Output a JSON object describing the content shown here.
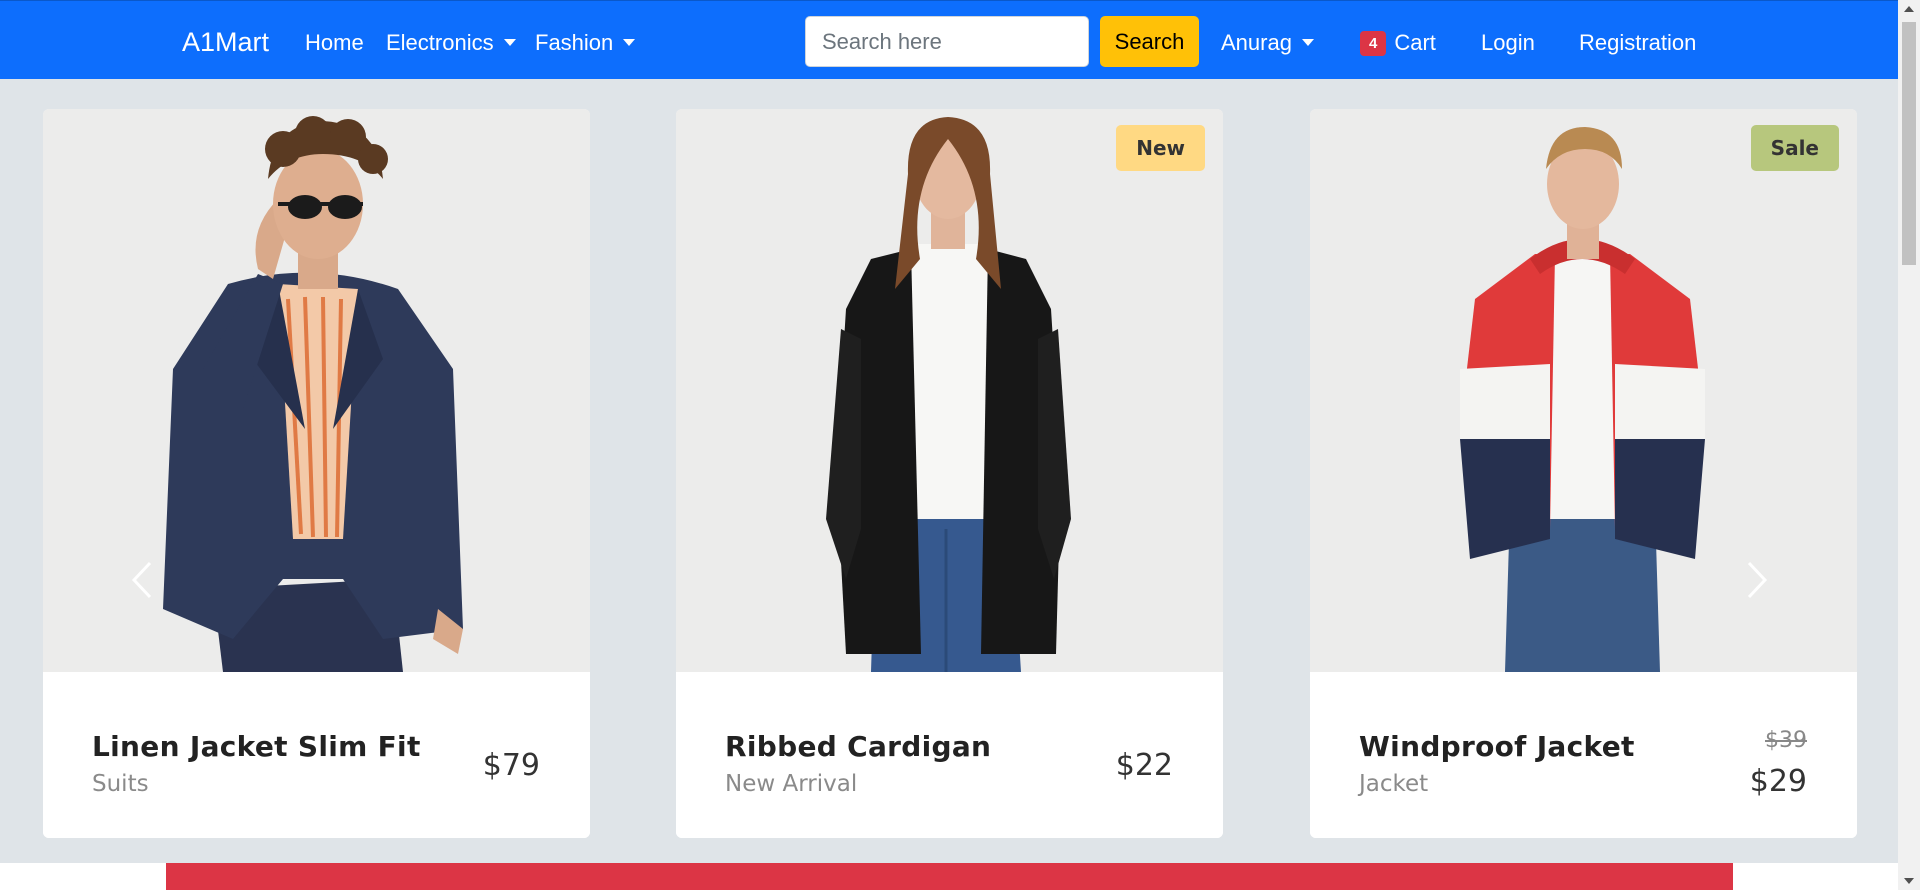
{
  "navbar": {
    "brand": "A1Mart",
    "links": {
      "home": "Home",
      "electronics": "Electronics",
      "fashion": "Fashion",
      "user": "Anurag",
      "login": "Login",
      "registration": "Registration"
    },
    "search": {
      "placeholder": "Search here",
      "value": "",
      "button": "Search"
    },
    "cart": {
      "count": "4",
      "label": "Cart"
    },
    "color": "#0d6efd"
  },
  "products": [
    {
      "name": "Linen Jacket Slim Fit",
      "category": "Suits",
      "price": "$79",
      "badge": "",
      "image": "man in navy suit and sunglasses"
    },
    {
      "name": "Ribbed Cardigan",
      "category": "New Arrival",
      "price": "$22",
      "badge": "New",
      "image": "woman in black cardigan"
    },
    {
      "name": "Windproof Jacket",
      "category": "Jacket",
      "old_price": "$39",
      "price": "$29",
      "badge": "Sale",
      "image": "man in red white navy jacket"
    }
  ],
  "colors": {
    "accent": "#ffc107",
    "badge_new": "#ffd983",
    "badge_sale": "#b7c77d",
    "cart_badge": "#dc3545",
    "banner": "#dc3545"
  }
}
